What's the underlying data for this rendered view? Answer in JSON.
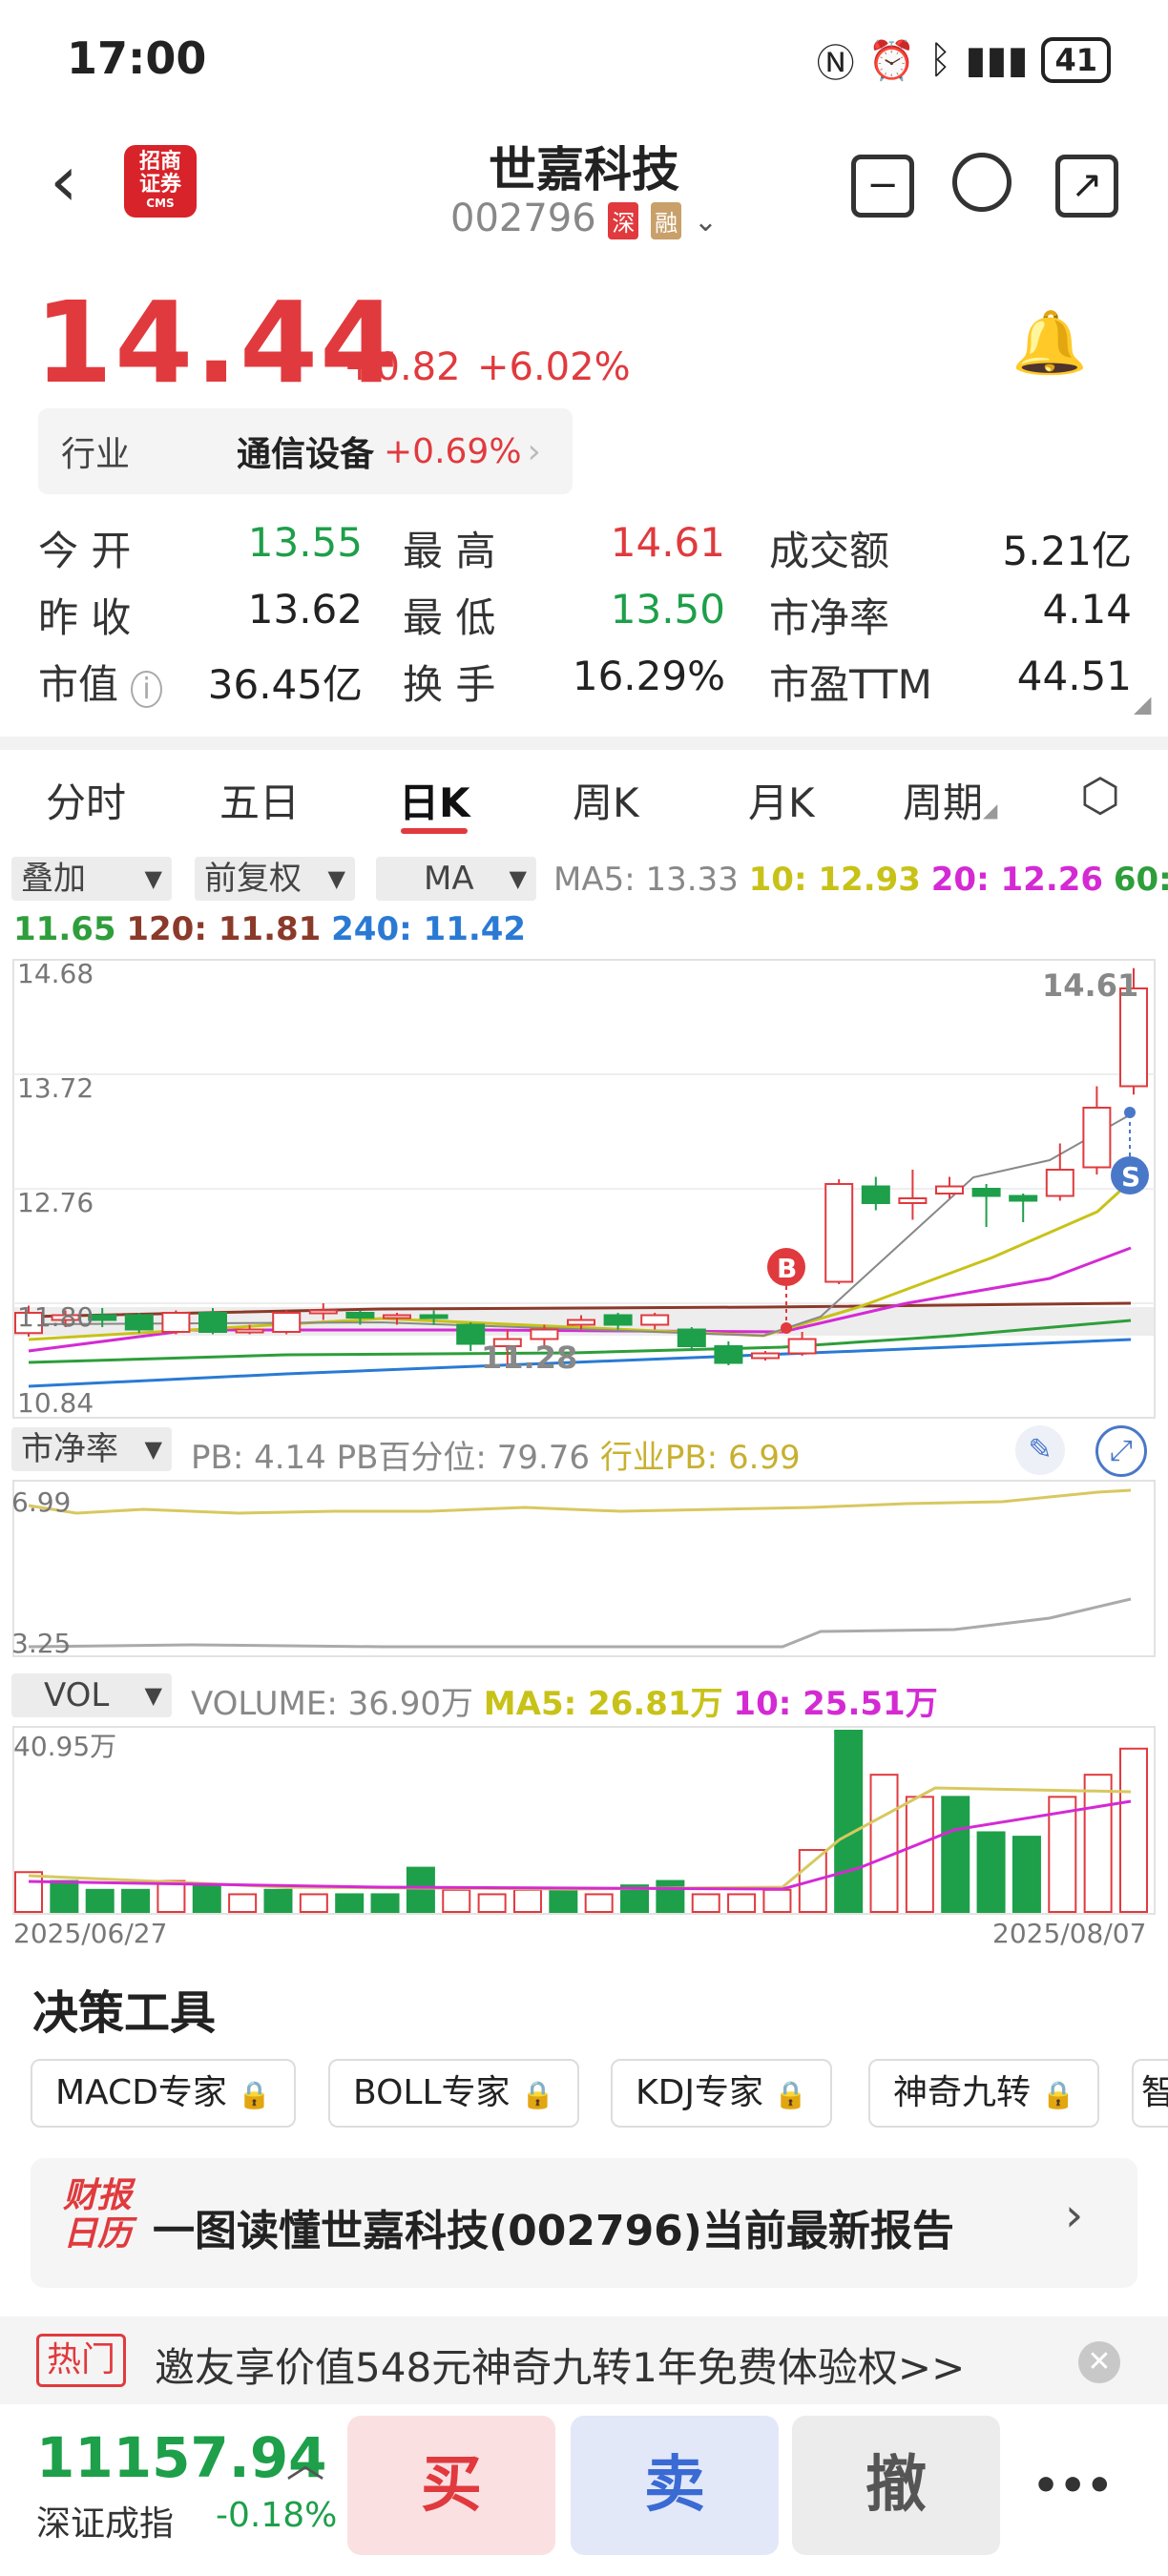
{
  "status_bar": {
    "time": "17:00",
    "battery": "41"
  },
  "header": {
    "logo_text": "招商证券",
    "logo_sub": "CMS",
    "stock_name": "世嘉科技",
    "stock_code": "002796",
    "tag_market": "深",
    "tag_margin": "融"
  },
  "price": {
    "last": "14.44",
    "change": "+0.82",
    "change_pct": "+6.02%"
  },
  "industry": {
    "label": "行业",
    "name": "通信设备",
    "change": "+0.69%"
  },
  "quote": {
    "open_label": "今 开",
    "open": "13.55",
    "high_label": "最 高",
    "high": "14.61",
    "amount_label": "成交额",
    "amount": "5.21亿",
    "prev_close_label": "昨 收",
    "prev_close": "13.62",
    "low_label": "最 低",
    "low": "13.50",
    "pb_label": "市净率",
    "pb": "4.14",
    "mkt_cap_label": "市值",
    "mkt_cap": "36.45亿",
    "turnover_label": "换 手",
    "turnover": "16.29%",
    "pe_label": "市盈TTM",
    "pe": "44.51"
  },
  "tabs": [
    "分时",
    "五日",
    "日K",
    "周K",
    "月K",
    "周期"
  ],
  "kline_controls": {
    "overlay": "叠加",
    "adjust": "前复权",
    "indicator": "MA"
  },
  "ma_legend": {
    "ma5": "MA5: 13.33",
    "ma10": "10: 12.93",
    "ma20": "20: 12.26",
    "ma60_a": "60:",
    "ma60_b": "11.65",
    "ma120": "120: 11.81",
    "ma240": "240: 11.42"
  },
  "kline_axis": {
    "y1": "14.68",
    "y2": "13.72",
    "y3": "12.76",
    "y4": "11.80",
    "y5": "10.84",
    "max_label": "14.61",
    "min_label": "11.28",
    "buy_mark": "B",
    "sell_mark": "S"
  },
  "pb_panel": {
    "selector": "市净率",
    "pb": "PB: 4.14",
    "pb_pct": "PB百分位: 79.76",
    "ind_pb": "行业PB: 6.99",
    "y_top": "6.99",
    "y_bottom": "3.25"
  },
  "vol_panel": {
    "selector": "VOL",
    "volume": "VOLUME: 36.90万",
    "ma5": "MA5: 26.81万",
    "ma10": "10: 25.51万",
    "y_top": "40.95万",
    "date_start": "2025/06/27",
    "date_end": "2025/08/07"
  },
  "colors": {
    "up": "#e03a3e",
    "down": "#1e9f4a",
    "ma5": "#888888",
    "ma10": "#c8c218",
    "ma20": "#d42ad4",
    "ma60": "#2e9e3a",
    "ma120": "#8b3a2a",
    "ma240": "#2a7ad4"
  },
  "chart_data": {
    "type": "candlestick",
    "ylim": [
      10.84,
      14.68
    ],
    "candles": [
      {
        "o": 11.55,
        "c": 11.72,
        "h": 11.78,
        "l": 11.52
      },
      {
        "o": 11.66,
        "c": 11.7,
        "h": 11.74,
        "l": 11.6
      },
      {
        "o": 11.7,
        "c": 11.66,
        "h": 11.76,
        "l": 11.6
      },
      {
        "o": 11.7,
        "c": 11.58,
        "h": 11.72,
        "l": 11.55
      },
      {
        "o": 11.56,
        "c": 11.72,
        "h": 11.74,
        "l": 11.54
      },
      {
        "o": 11.72,
        "c": 11.56,
        "h": 11.76,
        "l": 11.54
      },
      {
        "o": 11.58,
        "c": 11.58,
        "h": 11.62,
        "l": 11.54
      },
      {
        "o": 11.56,
        "c": 11.72,
        "h": 11.74,
        "l": 11.54
      },
      {
        "o": 11.74,
        "c": 11.74,
        "h": 11.8,
        "l": 11.66
      },
      {
        "o": 11.72,
        "c": 11.68,
        "h": 11.74,
        "l": 11.62
      },
      {
        "o": 11.68,
        "c": 11.7,
        "h": 11.72,
        "l": 11.62
      },
      {
        "o": 11.7,
        "c": 11.68,
        "h": 11.74,
        "l": 11.62
      },
      {
        "o": 11.62,
        "c": 11.46,
        "h": 11.64,
        "l": 11.4
      },
      {
        "o": 11.44,
        "c": 11.5,
        "h": 11.58,
        "l": 11.28
      },
      {
        "o": 11.5,
        "c": 11.58,
        "h": 11.62,
        "l": 11.42
      },
      {
        "o": 11.62,
        "c": 11.66,
        "h": 11.7,
        "l": 11.58
      },
      {
        "o": 11.7,
        "c": 11.62,
        "h": 11.72,
        "l": 11.58
      },
      {
        "o": 11.62,
        "c": 11.7,
        "h": 11.72,
        "l": 11.58
      },
      {
        "o": 11.58,
        "c": 11.44,
        "h": 11.6,
        "l": 11.4
      },
      {
        "o": 11.44,
        "c": 11.3,
        "h": 11.48,
        "l": 11.28
      },
      {
        "o": 11.34,
        "c": 11.38,
        "h": 11.4,
        "l": 11.32
      },
      {
        "o": 11.38,
        "c": 11.5,
        "h": 11.56,
        "l": 11.36
      },
      {
        "o": 11.98,
        "c": 12.8,
        "h": 12.84,
        "l": 11.96
      },
      {
        "o": 12.78,
        "c": 12.64,
        "h": 12.86,
        "l": 12.58
      },
      {
        "o": 12.64,
        "c": 12.68,
        "h": 12.92,
        "l": 12.5
      },
      {
        "o": 12.72,
        "c": 12.78,
        "h": 12.86,
        "l": 12.68
      },
      {
        "o": 12.76,
        "c": 12.7,
        "h": 12.8,
        "l": 12.44
      },
      {
        "o": 12.7,
        "c": 12.66,
        "h": 12.72,
        "l": 12.48
      },
      {
        "o": 12.7,
        "c": 12.92,
        "h": 13.14,
        "l": 12.66
      },
      {
        "o": 12.94,
        "c": 13.44,
        "h": 13.62,
        "l": 12.88
      },
      {
        "o": 13.62,
        "c": 14.44,
        "h": 14.61,
        "l": 13.55
      }
    ],
    "pb_series": {
      "ind_pb_range": [
        3.25,
        6.99
      ]
    },
    "volume": {
      "ymax": 40.95,
      "bars": [
        9,
        7,
        5,
        5,
        7,
        6,
        4,
        5,
        4,
        4,
        4,
        10,
        5,
        4,
        5,
        5,
        4,
        6,
        7,
        4,
        4,
        5,
        14,
        40.95,
        31,
        26,
        26,
        18,
        17,
        26,
        31,
        36.9
      ],
      "up": [
        1,
        0,
        0,
        0,
        1,
        0,
        1,
        0,
        1,
        0,
        0,
        0,
        1,
        1,
        1,
        0,
        1,
        0,
        0,
        1,
        1,
        1,
        1,
        0,
        1,
        1,
        0,
        0,
        0,
        1,
        1,
        1
      ]
    }
  },
  "tools": {
    "title": "决策工具",
    "items": [
      "MACD专家",
      "BOLL专家",
      "KDJ专家",
      "神奇九转",
      "智"
    ]
  },
  "report": {
    "logo_a": "财报",
    "logo_b": "日历",
    "title": "一图读懂世嘉科技(002796)当前最新报告"
  },
  "hot": {
    "badge": "热门",
    "text": "邀友享价值548元神奇九转1年免费体验权>>"
  },
  "bottom": {
    "index_value": "11157.94",
    "index_name": "深证成指",
    "index_change": "-0.18%",
    "buy": "买",
    "sell": "卖",
    "cancel": "撤",
    "more": "•••"
  }
}
